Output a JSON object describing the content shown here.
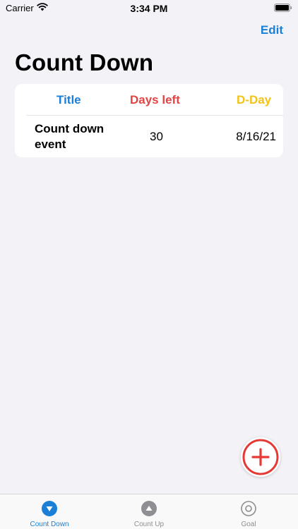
{
  "status_bar": {
    "carrier": "Carrier",
    "time": "3:34 PM"
  },
  "nav": {
    "edit_label": "Edit",
    "title": "Count Down"
  },
  "table": {
    "headers": {
      "title": "Title",
      "days_left": "Days left",
      "dday": "D-Day"
    },
    "rows": [
      {
        "title": "Count down event",
        "days_left": "30",
        "dday": "8/16/21"
      }
    ]
  },
  "fab": {
    "icon": "plus-circle-icon"
  },
  "tabs": [
    {
      "label": "Count Down",
      "icon": "triangle-down-circle-icon",
      "selected": true
    },
    {
      "label": "Count Up",
      "icon": "triangle-up-circle-icon",
      "selected": false
    },
    {
      "label": "Goal",
      "icon": "target-circle-icon",
      "selected": false
    }
  ],
  "colors": {
    "accent_blue": "#1a7fd6",
    "days_red": "#e24444",
    "dday_yellow": "#f2c31a",
    "fab_red": "#e53935",
    "tab_inactive": "#8e8e93",
    "background": "#f2f2f7"
  }
}
